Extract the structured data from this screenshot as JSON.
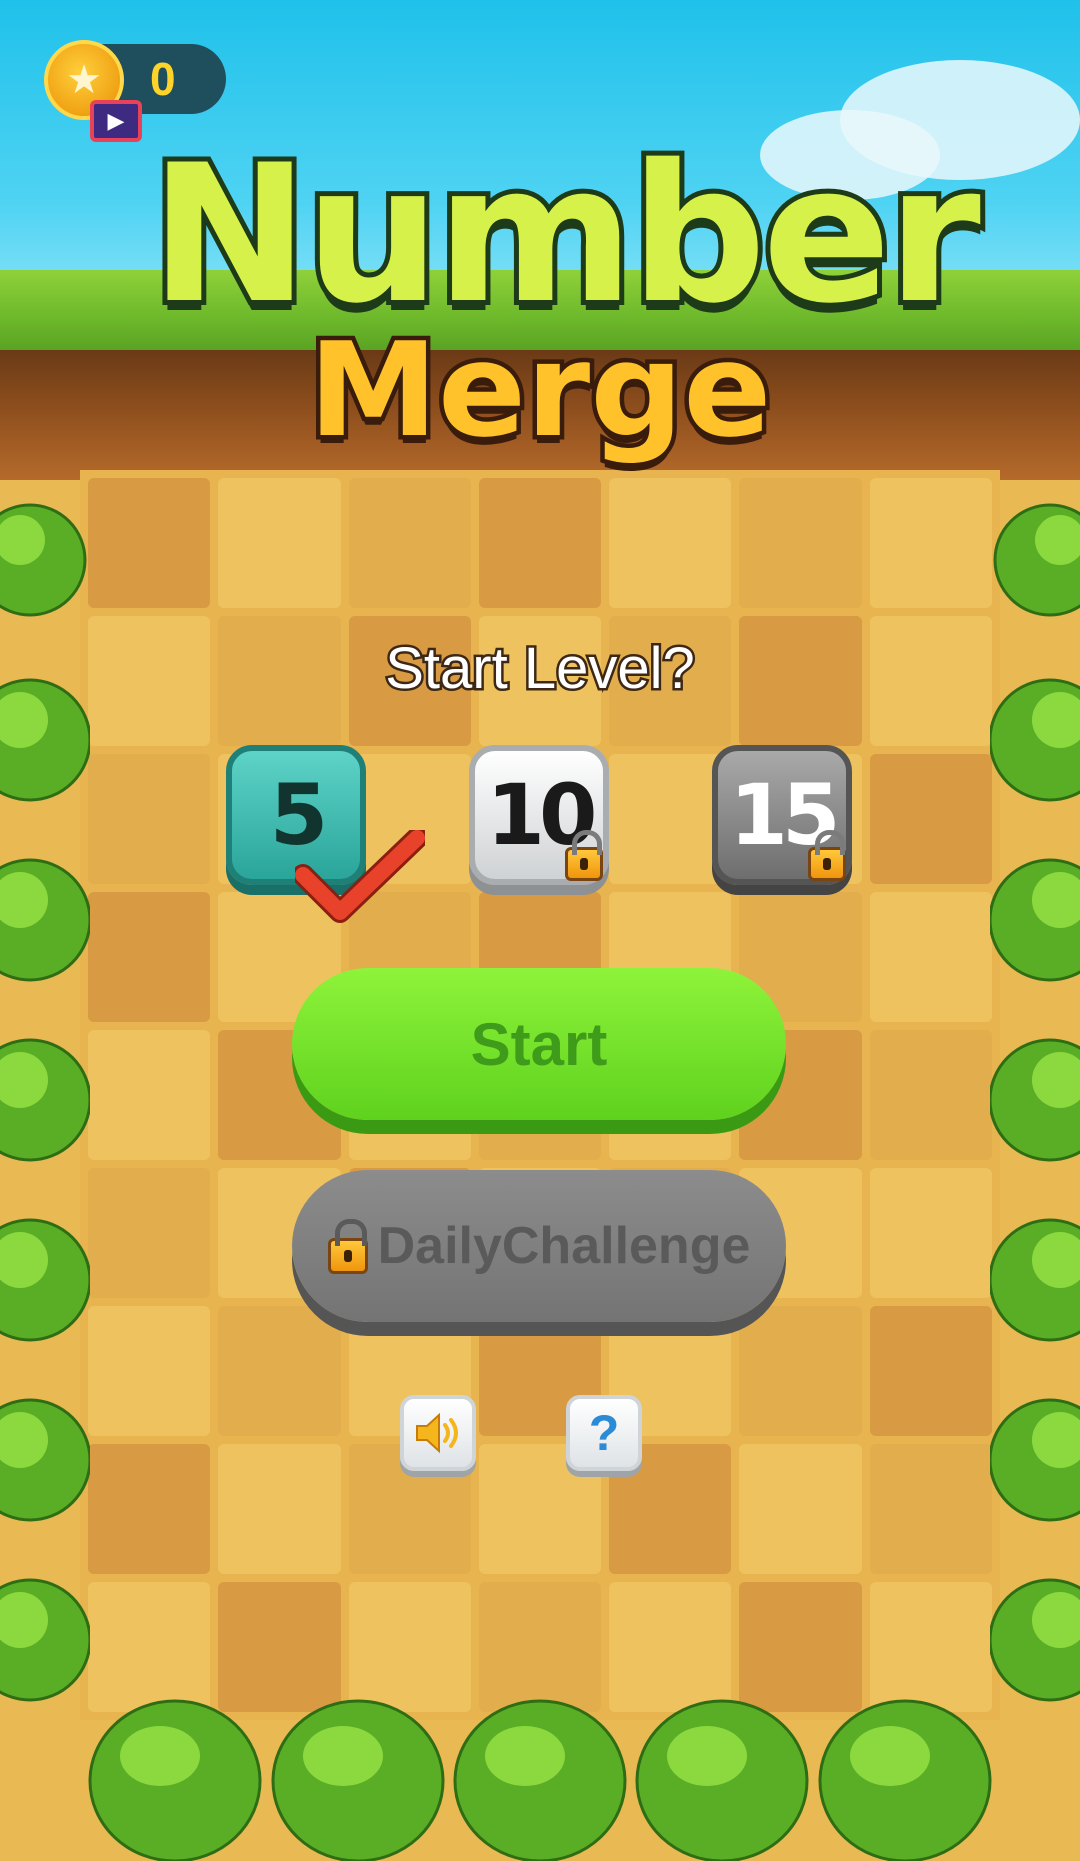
{
  "hud": {
    "coins": "0"
  },
  "title": {
    "line1": "Number",
    "line2": "Merge"
  },
  "prompt": "Start Level?",
  "levels": [
    {
      "label": "5",
      "selected": true,
      "locked": false
    },
    {
      "label": "10",
      "selected": false,
      "locked": true
    },
    {
      "label": "15",
      "selected": false,
      "locked": true
    }
  ],
  "buttons": {
    "start": "Start",
    "daily": "DailyChallenge",
    "help": "?"
  },
  "icons": {
    "coin": "star-coin-icon",
    "video": "video-play-icon",
    "check": "checkmark-icon",
    "lock": "lock-icon",
    "sound": "speaker-icon",
    "help": "question-icon"
  },
  "colors": {
    "start_button": "#7fe82d",
    "daily_button": "#7e7e7e",
    "level_selected": "#3cbfb3"
  }
}
